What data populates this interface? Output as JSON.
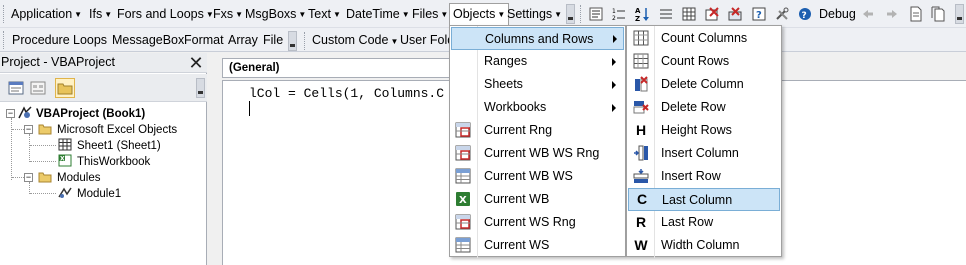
{
  "toolbar_menus": [
    {
      "label": "Application"
    },
    {
      "label": "Ifs"
    },
    {
      "label": "Fors and Loops"
    },
    {
      "label": "Fxs"
    },
    {
      "label": "MsgBoxs"
    },
    {
      "label": "Text"
    },
    {
      "label": "DateTime"
    },
    {
      "label": "Files"
    },
    {
      "label": "Objects"
    },
    {
      "label": "Settings"
    }
  ],
  "debug_label": "Debug",
  "toolbar2": {
    "items": [
      "Procedure",
      "Loops",
      "MessageBox",
      "Format",
      "Array",
      "File"
    ],
    "custom_code": "Custom Code",
    "user_folder": "User Fold"
  },
  "project_pane": {
    "title": "Project - VBAProject",
    "close_glyph": "✕",
    "tree": {
      "root": "VBAProject (Book1)",
      "excel_objects": "Microsoft Excel Objects",
      "sheet1": "Sheet1 (Sheet1)",
      "thisworkbook": "ThisWorkbook",
      "modules": "Modules",
      "module1": "Module1"
    }
  },
  "code_pane": {
    "object_combo": "(General)",
    "line1": "lCol = Cells(1, Columns.C"
  },
  "objects_menu": {
    "items": [
      {
        "label": "Columns and Rows",
        "submenu": true,
        "highlighted": true
      },
      {
        "label": "Ranges",
        "submenu": true
      },
      {
        "label": "Sheets",
        "submenu": true
      },
      {
        "label": "Workbooks",
        "submenu": true
      },
      {
        "label": "Current Rng",
        "icon": "range-icon"
      },
      {
        "label": "Current WB WS Rng",
        "icon": "range-icon"
      },
      {
        "label": "Current WB WS",
        "icon": "sheet-icon"
      },
      {
        "label": "Current WB",
        "icon": "excel-icon"
      },
      {
        "label": "Current WS Rng",
        "icon": "range-icon"
      },
      {
        "label": "Current WS",
        "icon": "sheet-icon"
      }
    ]
  },
  "columns_rows_menu": {
    "items": [
      {
        "label": "Count Columns",
        "icon": "count-columns-icon"
      },
      {
        "label": "Count Rows",
        "icon": "count-rows-icon"
      },
      {
        "label": "Delete Column",
        "icon": "delete-column-icon"
      },
      {
        "label": "Delete Row",
        "icon": "delete-row-icon"
      },
      {
        "label": "Height Rows",
        "letter": "H"
      },
      {
        "label": "Insert Column",
        "icon": "insert-column-icon"
      },
      {
        "label": "Insert Row",
        "icon": "insert-row-icon"
      },
      {
        "label": "Last Column",
        "letter": "C",
        "highlighted": true
      },
      {
        "label": "Last Row",
        "letter": "R"
      },
      {
        "label": "Width Column",
        "letter": "W"
      }
    ]
  },
  "colors": {
    "highlight_bg": "#cce4f7",
    "highlight_border": "#7aaed6",
    "toolbar_bg": "#eef0f4"
  }
}
